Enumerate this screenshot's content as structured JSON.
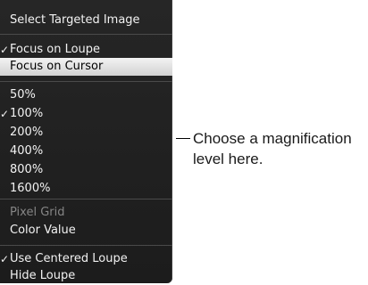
{
  "menu": {
    "select_targeted_image": "Select Targeted Image",
    "focus_on_loupe": "Focus on Loupe",
    "focus_on_cursor": "Focus on Cursor",
    "zoom_levels": [
      "50%",
      "100%",
      "200%",
      "400%",
      "800%",
      "1600%"
    ],
    "pixel_grid": "Pixel Grid",
    "color_value": "Color Value",
    "use_centered_loupe": "Use Centered Loupe",
    "hide_loupe": "Hide Loupe",
    "checkmark": "✓"
  },
  "callout": {
    "text": "Choose a magnification level here."
  }
}
